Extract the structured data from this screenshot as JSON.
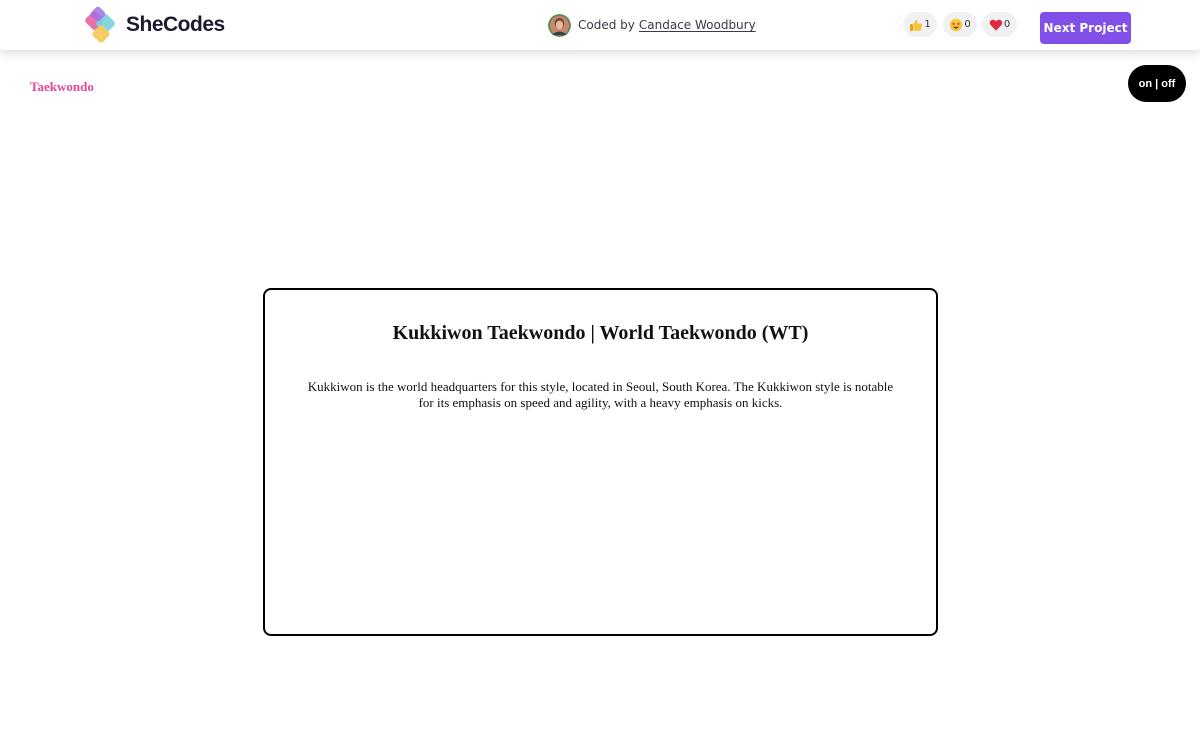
{
  "header": {
    "logo_text": "SheCodes",
    "coded_by_prefix": "Coded by",
    "author_name": "Candace Woodbury",
    "reactions": [
      {
        "icon": "thumbs-up-icon",
        "count": "1"
      },
      {
        "icon": "star-struck-icon",
        "count": "0"
      },
      {
        "icon": "heart-icon",
        "count": "0"
      }
    ],
    "next_button_label": "Next Project",
    "colors": {
      "accent": "#8150e8",
      "reaction_bg": "#f1f1f4"
    }
  },
  "page": {
    "brand": "Taekwondo",
    "brand_color": "#e0479e",
    "toggle_label": "on | off"
  },
  "card": {
    "title": "Kukkiwon Taekwondo | World Taekwondo (WT)",
    "body": "Kukkiwon is the world headquarters for this style, located in Seoul, South Korea. The Kukkiwon style is notable for its emphasis on speed and agility, with a heavy emphasis on kicks."
  }
}
